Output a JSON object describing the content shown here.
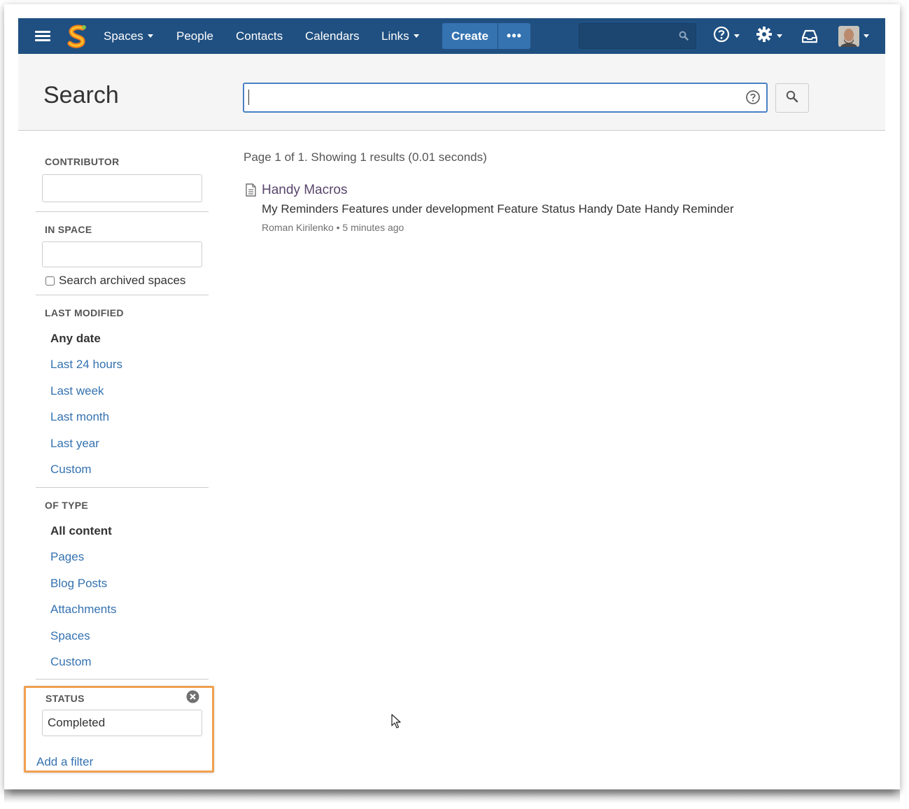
{
  "header": {
    "nav": [
      {
        "label": "Spaces",
        "dropdown": true
      },
      {
        "label": "People",
        "dropdown": false
      },
      {
        "label": "Contacts",
        "dropdown": false
      },
      {
        "label": "Calendars",
        "dropdown": false
      },
      {
        "label": "Links",
        "dropdown": true
      }
    ],
    "create_label": "Create",
    "more_label": "•••",
    "quick_search_placeholder": "",
    "icons": [
      "menu-icon",
      "logo",
      "search-icon",
      "help-icon",
      "gear-icon",
      "notifications-icon",
      "avatar"
    ]
  },
  "search": {
    "title": "Search",
    "query": "",
    "placeholder": ""
  },
  "sidebar": {
    "contributor": {
      "title": "CONTRIBUTOR",
      "value": ""
    },
    "in_space": {
      "title": "IN SPACE",
      "value": "",
      "archived_label": "Search archived spaces",
      "archived_checked": false
    },
    "last_modified": {
      "title": "LAST MODIFIED",
      "options": [
        "Any date",
        "Last 24 hours",
        "Last week",
        "Last month",
        "Last year",
        "Custom"
      ],
      "selected": "Any date"
    },
    "of_type": {
      "title": "OF TYPE",
      "options": [
        "All content",
        "Pages",
        "Blog Posts",
        "Attachments",
        "Spaces",
        "Custom"
      ],
      "selected": "All content"
    },
    "status": {
      "title": "STATUS",
      "value": "Completed"
    },
    "add_filter_label": "Add a filter"
  },
  "results": {
    "summary": "Page 1 of 1. Showing 1 results (0.01 seconds)",
    "items": [
      {
        "title": "Handy Macros",
        "excerpt": "My Reminders Features under development Feature Status Handy Date Handy Reminder",
        "meta": "Roman Kirilenko • 5 minutes ago"
      }
    ]
  },
  "colors": {
    "header_bg": "#205081",
    "create_bg": "#3572b0",
    "link": "#3572b0",
    "visited_link": "#59466d",
    "highlight": "#f0a050"
  }
}
